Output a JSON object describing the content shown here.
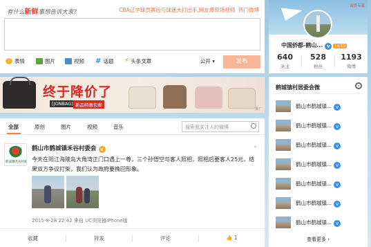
{
  "publisher": {
    "prompt_prefix": "有什么",
    "prompt_emph": "新鲜",
    "prompt_suffix": "事想告诉大家?",
    "hot_topic": "CBA辽宁球员赛后与球迷大打出手,网友爆现场视频",
    "hot_label": "热门微博",
    "tools": {
      "emoji": "表情",
      "image": "图片",
      "video": "视频",
      "topic": "话题",
      "article": "头条文章"
    },
    "visibility": "公开 ▾",
    "send": "发布"
  },
  "banner": {
    "title": "终于降价了",
    "brand": "[JONBAG]",
    "promo": "新品特惠包邮",
    "tag": "推广"
  },
  "feed": {
    "tabs": [
      "全部",
      "原创",
      "图片",
      "视频",
      "音乐"
    ],
    "search_placeholder": "搜索我关注人的微博",
    "post": {
      "avatar_text": "鹤城镇禾谷村委会",
      "author": "鹤山市鹤城镇禾谷村委会",
      "menu": "⌄",
      "text": "今天在阳江海陵岛大角湾正门口遇上一尊，三个孙悟空与客人照相，照相后要客人25元，结果双方争议打架，我们认为政府要挽回形象。",
      "timestamp": "2015-8-28 22:42",
      "source": "来自 UC浏览器iPhone版",
      "actions": {
        "favorite": "收藏",
        "repost": "转发",
        "comment": "评论",
        "like": "👍 1"
      }
    }
  },
  "profile": {
    "vip_label": "会员专享",
    "name": "中国侨都-鹤山...",
    "level": "Lv.15",
    "following_count": "640",
    "following_label": "关注",
    "followers_count": "528",
    "followers_label": "粉丝",
    "weibo_count": "1193",
    "weibo_label": "微博"
  },
  "related": {
    "title": "鹤城镇村居委会微",
    "items": [
      {
        "name": "鹤山市鹤城镇..."
      },
      {
        "name": "鹤山市鹤城镇..."
      },
      {
        "name": "鹤山市鹤城镇..."
      },
      {
        "name": "鹤山市鹤城镇..."
      },
      {
        "name": "鹤山市鹤城镇..."
      },
      {
        "name": "鹤山市鹤城镇..."
      },
      {
        "name": "鹤山市鹤城镇..."
      }
    ],
    "more": "查看更多 ›"
  },
  "colors": {
    "accent_orange": "#fa7d3c",
    "send_button": "#f7b698",
    "verified_blue": "#3a8ee6",
    "verified_gold": "#f5a623",
    "banner_red": "#d32a22"
  }
}
